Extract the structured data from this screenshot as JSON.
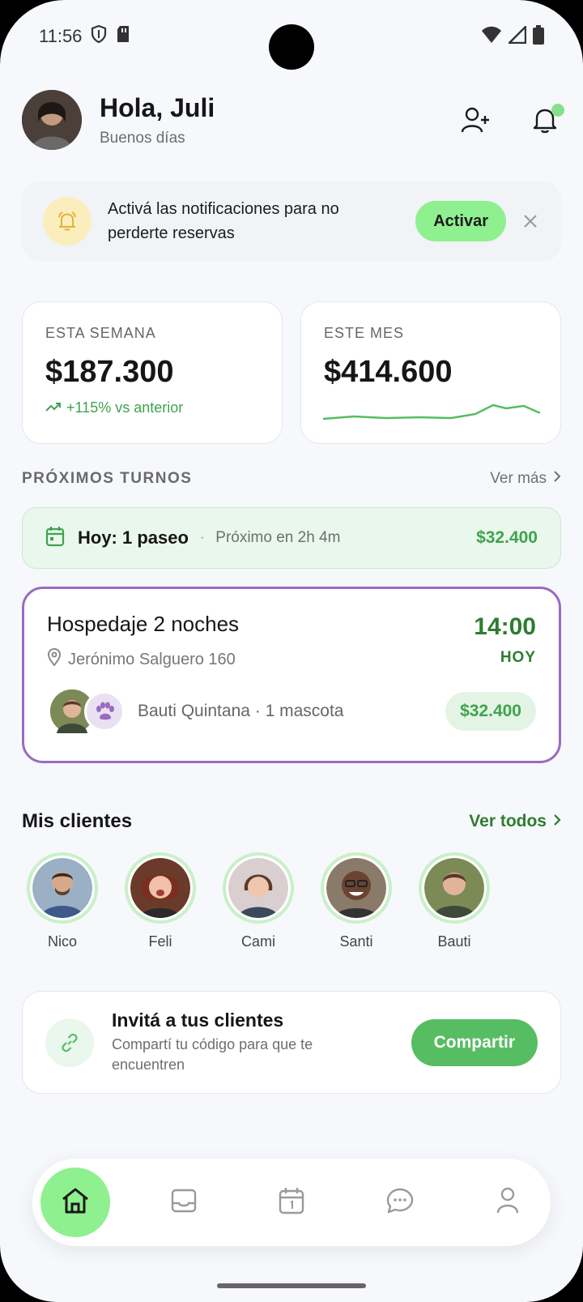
{
  "status_bar": {
    "time": "11:56"
  },
  "header": {
    "greeting": "Hola, Juli",
    "subtitle": "Buenos días"
  },
  "banner": {
    "text": "Activá las notificaciones para no perderte reservas",
    "button": "Activar"
  },
  "stats": {
    "week": {
      "label": "ESTA SEMANA",
      "value": "$187.300",
      "trend": "+115% vs anterior"
    },
    "month": {
      "label": "ESTE MES",
      "value": "$414.600"
    }
  },
  "upcoming": {
    "title": "PRÓXIMOS TURNOS",
    "link": "Ver más"
  },
  "today": {
    "title": "Hoy: 1 paseo",
    "dot": "·",
    "next": "Próximo en 2h 4m",
    "price": "$32.400"
  },
  "booking": {
    "title": "Hospedaje 2 noches",
    "address": "Jerónimo Salguero 160",
    "time": "14:00",
    "day": "HOY",
    "client": "Bauti Quintana · 1 mascota",
    "price": "$32.400"
  },
  "clients": {
    "title": "Mis clientes",
    "link": "Ver todos",
    "items": [
      {
        "name": "Nico"
      },
      {
        "name": "Feli"
      },
      {
        "name": "Cami"
      },
      {
        "name": "Santi"
      },
      {
        "name": "Bauti"
      }
    ]
  },
  "invite": {
    "title": "Invitá a tus clientes",
    "subtitle": "Compartí tu código para que te encuentren",
    "button": "Compartir"
  },
  "nav": {
    "items": [
      "home-icon",
      "inbox-icon",
      "calendar-icon",
      "chat-icon",
      "profile-icon"
    ],
    "active": "home-icon"
  },
  "colors": {
    "accent": "#8ff08f",
    "green_text": "#2e7d32",
    "purple_border": "#9a6bbf",
    "background": "#f6f8fb"
  }
}
